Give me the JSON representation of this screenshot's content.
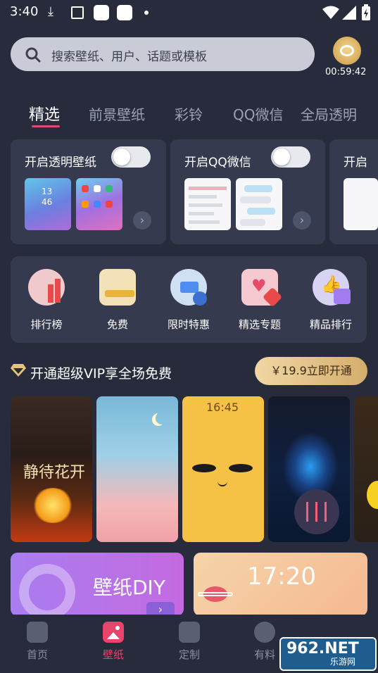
{
  "status_bar": {
    "time": "3:40"
  },
  "search": {
    "placeholder": "搜索壁纸、用户、话题或模板",
    "timer": "00:59:42"
  },
  "tabs": [
    {
      "label": "精选"
    },
    {
      "label": "前景壁纸"
    },
    {
      "label": "彩铃"
    },
    {
      "label": "QQ微信"
    },
    {
      "label": "全局透明"
    }
  ],
  "cards": [
    {
      "title": "开启透明壁纸",
      "thumb_clock": "13",
      "thumb_clock2": "46"
    },
    {
      "title": "开启QQ微信"
    },
    {
      "title": "开启"
    }
  ],
  "menu": [
    {
      "label": "排行榜"
    },
    {
      "label": "免费"
    },
    {
      "label": "限时特惠"
    },
    {
      "label": "精选专题"
    },
    {
      "label": "精品排行"
    }
  ],
  "vip": {
    "text": "开通超级VIP享全场免费",
    "button": "￥19.9立即开通"
  },
  "wallpapers": {
    "clock_time": "16:45"
  },
  "banners": [
    {
      "label": "壁纸DIY"
    },
    {
      "label": "17:20"
    }
  ],
  "nav": [
    {
      "label": "首页"
    },
    {
      "label": "壁纸"
    },
    {
      "label": "定制"
    },
    {
      "label": "有料"
    }
  ],
  "watermark": {
    "big": "962.NET",
    "small": "乐游网"
  },
  "colors": {
    "accent": "#e8456b",
    "background": "#272b3c",
    "card": "#353a4e",
    "vip_gold": "#d4ad6c"
  }
}
